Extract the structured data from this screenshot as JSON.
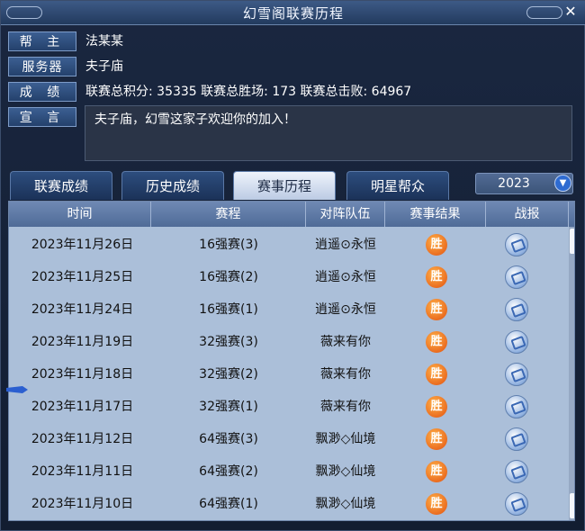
{
  "window": {
    "title": "幻雪阁联赛历程"
  },
  "info": {
    "leader_label": "帮 主",
    "leader_value": "法某某",
    "server_label": "服务器",
    "server_value": "夫子庙",
    "score_label": "成 绩",
    "score_value": "联赛总积分:  35335   联赛总胜场:  173   联赛总击败:  64967",
    "motto_label": "宣 言",
    "motto_value": "夫子庙，幻雪这家子欢迎你的加入！"
  },
  "tabs": [
    "联赛成绩",
    "历史成绩",
    "赛事历程",
    "明星帮众"
  ],
  "year": "2023",
  "table": {
    "headers": [
      "时间",
      "赛程",
      "对阵队伍",
      "赛事结果",
      "战报"
    ],
    "rows": [
      {
        "date": "2023年11月26日",
        "stage": "16强赛(3)",
        "opponent": "逍遥⊙永恒",
        "result": "胜"
      },
      {
        "date": "2023年11月25日",
        "stage": "16强赛(2)",
        "opponent": "逍遥⊙永恒",
        "result": "胜"
      },
      {
        "date": "2023年11月24日",
        "stage": "16强赛(1)",
        "opponent": "逍遥⊙永恒",
        "result": "胜"
      },
      {
        "date": "2023年11月19日",
        "stage": "32强赛(3)",
        "opponent": "薇来有你",
        "result": "胜"
      },
      {
        "date": "2023年11月18日",
        "stage": "32强赛(2)",
        "opponent": "薇来有你",
        "result": "胜"
      },
      {
        "date": "2023年11月17日",
        "stage": "32强赛(1)",
        "opponent": "薇来有你",
        "result": "胜"
      },
      {
        "date": "2023年11月12日",
        "stage": "64强赛(3)",
        "opponent": "飘渺◇仙境",
        "result": "胜"
      },
      {
        "date": "2023年11月11日",
        "stage": "64强赛(2)",
        "opponent": "飘渺◇仙境",
        "result": "胜"
      },
      {
        "date": "2023年11月10日",
        "stage": "64强赛(1)",
        "opponent": "飘渺◇仙境",
        "result": "胜"
      }
    ]
  },
  "icons": {
    "close": "close-icon",
    "dropdown": "chevron-down-icon",
    "report": "battle-report-icon",
    "cursor": "pointer-icon"
  }
}
